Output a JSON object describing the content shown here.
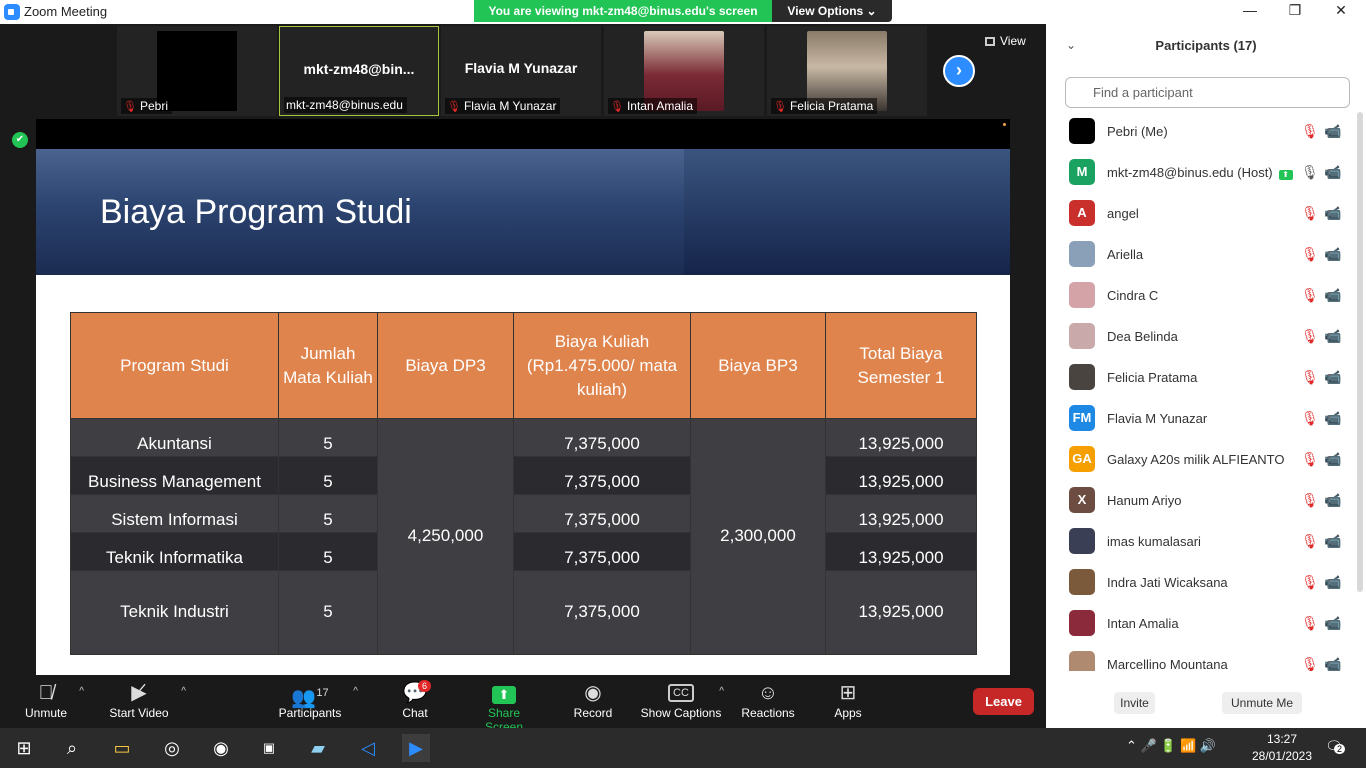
{
  "window": {
    "title": "Zoom Meeting",
    "viewing_banner": "You are viewing mkt-zm48@binus.edu's screen",
    "view_options": "View Options ⌄",
    "minimize": "—",
    "restore": "❐",
    "close": "✕"
  },
  "video_strip": {
    "tiles": [
      {
        "name": "Pebri"
      },
      {
        "name": "mkt-zm48@binus.edu",
        "big_name": "mkt-zm48@bin..."
      },
      {
        "name": "Flavia M Yunazar",
        "big_name": "Flavia M Yunazar"
      },
      {
        "name": "Intan Amalia"
      },
      {
        "name": "Felicia Pratama"
      }
    ],
    "next": "›",
    "view_label": "View"
  },
  "slide": {
    "title": "Biaya Program Studi",
    "headers": [
      "Program Studi",
      "Jumlah Mata Kuliah",
      "Biaya DP3",
      "Biaya Kuliah (Rp1.475.000/ mata kuliah)",
      "Biaya BP3",
      "Total Biaya Semester 1"
    ],
    "rows": [
      {
        "program": "Akuntansi",
        "jumlah": "5",
        "kuliah": "7,375,000",
        "total": "13,925,000"
      },
      {
        "program": "Business Management",
        "jumlah": "5",
        "kuliah": "7,375,000",
        "total": "13,925,000"
      },
      {
        "program": "Sistem Informasi",
        "jumlah": "5",
        "kuliah": "7,375,000",
        "total": "13,925,000"
      },
      {
        "program": "Teknik Informatika",
        "jumlah": "5",
        "kuliah": "7,375,000",
        "total": "13,925,000"
      },
      {
        "program": "Teknik Industri",
        "jumlah": "5",
        "kuliah": "7,375,000",
        "total": "13,925,000"
      }
    ],
    "dp3": "4,250,000",
    "bp3": "2,300,000"
  },
  "toolbar": {
    "unmute": "Unmute",
    "start_video": "Start Video",
    "participants": "Participants",
    "participants_count": "17",
    "chat": "Chat",
    "chat_badge": "6",
    "share_screen": "Share Screen",
    "record": "Record",
    "show_captions": "Show Captions",
    "reactions": "Reactions",
    "apps": "Apps",
    "leave": "Leave"
  },
  "panel": {
    "title": "Participants (17)",
    "search_placeholder": "Find a participant",
    "participants": [
      {
        "name": "Pebri (Me)",
        "initials": "",
        "color": "#000000",
        "mic": "muted"
      },
      {
        "name": "mkt-zm48@binus.edu (Host)",
        "initials": "M",
        "color": "#1aa260",
        "mic": "on",
        "sharing": true
      },
      {
        "name": "angel",
        "initials": "A",
        "color": "#c9302c",
        "mic": "muted"
      },
      {
        "name": "Ariella",
        "initials": "",
        "color": "#8aa0b8",
        "mic": "muted"
      },
      {
        "name": "Cindra C",
        "initials": "",
        "color": "#d4a3a8",
        "mic": "muted"
      },
      {
        "name": "Dea Belinda",
        "initials": "",
        "color": "#c9a9aa",
        "mic": "muted"
      },
      {
        "name": "Felicia Pratama",
        "initials": "",
        "color": "#4a4440",
        "mic": "muted"
      },
      {
        "name": "Flavia M Yunazar",
        "initials": "FM",
        "color": "#1e88e5",
        "mic": "muted"
      },
      {
        "name": "Galaxy A20s milik ALFIEANTO",
        "initials": "GA",
        "color": "#f5a000",
        "mic": "muted"
      },
      {
        "name": "Hanum Ariyo",
        "initials": "X",
        "color": "#6d4c41",
        "mic": "muted"
      },
      {
        "name": "imas kumalasari",
        "initials": "",
        "color": "#3a3f55",
        "mic": "muted"
      },
      {
        "name": "Indra Jati Wicaksana",
        "initials": "",
        "color": "#7a5a3a",
        "mic": "muted"
      },
      {
        "name": "Intan Amalia",
        "initials": "",
        "color": "#8b2a3a",
        "mic": "muted"
      },
      {
        "name": "Marcellino Mountana",
        "initials": "",
        "color": "#b08a70",
        "mic": "muted"
      }
    ],
    "invite": "Invite",
    "unmute_me": "Unmute Me"
  },
  "taskbar": {
    "time": "13:27",
    "date": "28/01/2023",
    "notifications": "2"
  }
}
